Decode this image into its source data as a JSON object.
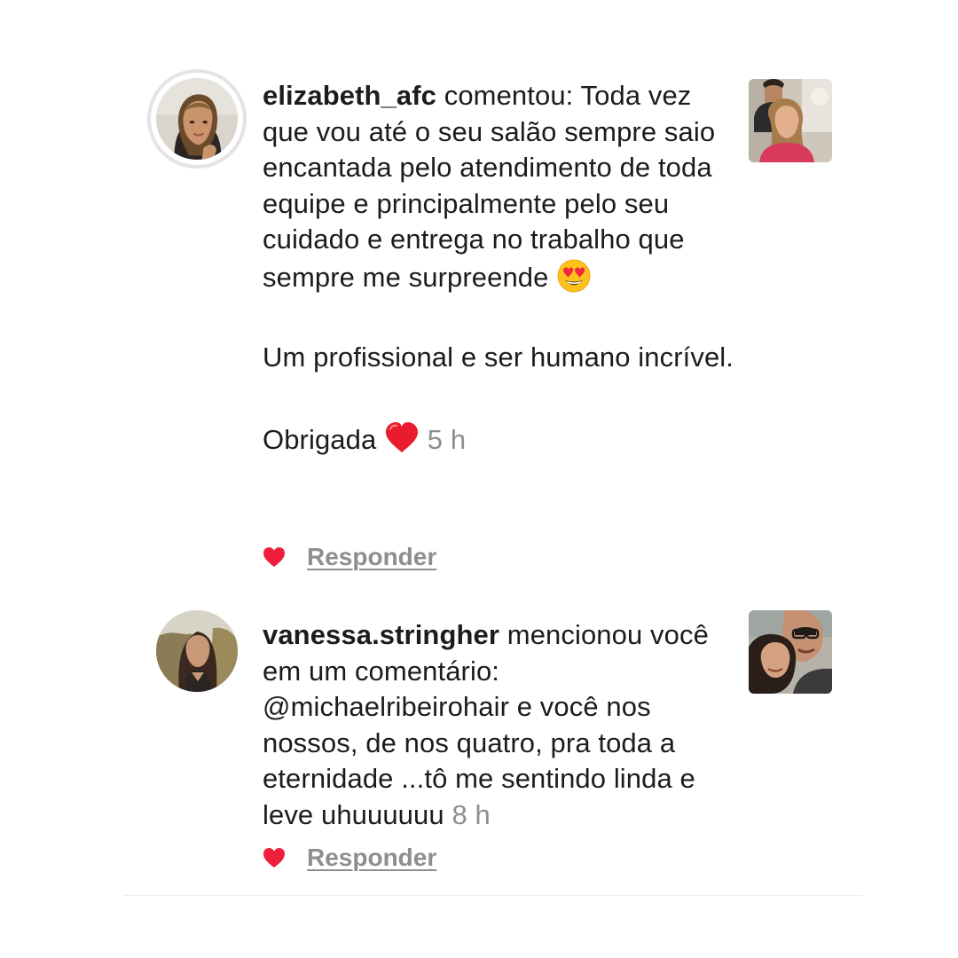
{
  "notifications": [
    {
      "username": "elizabeth_afc",
      "action": "comentou:",
      "paragraphs": [
        "Toda vez que vou até o seu salão sempre saio encantada pelo atendimento de toda equipe e principalmente pelo seu cuidado e entrega no trabalho que sempre me surpreende",
        "Um profissional e ser humano incrível.",
        "Obrigada"
      ],
      "emoji_1": "heart-eyes-emoji",
      "emoji_2": "red-heart-emoji",
      "time": "5 h",
      "reply_label": "Responder",
      "liked": true
    },
    {
      "username": "vanessa.stringher",
      "action": "mencionou você em um comentário:",
      "body": "@michaelribeirohair e você nos nossos, de nos quatro, pra toda a eternidade ...tô me sentindo linda e leve uhuuuuuu",
      "time": "8 h",
      "reply_label": "Responder",
      "liked": true
    }
  ],
  "colors": {
    "text": "#1c1c1c",
    "muted": "#8e8e8e",
    "like_red": "#ed1f3d",
    "avatar_ring": "#e4e4e4"
  }
}
